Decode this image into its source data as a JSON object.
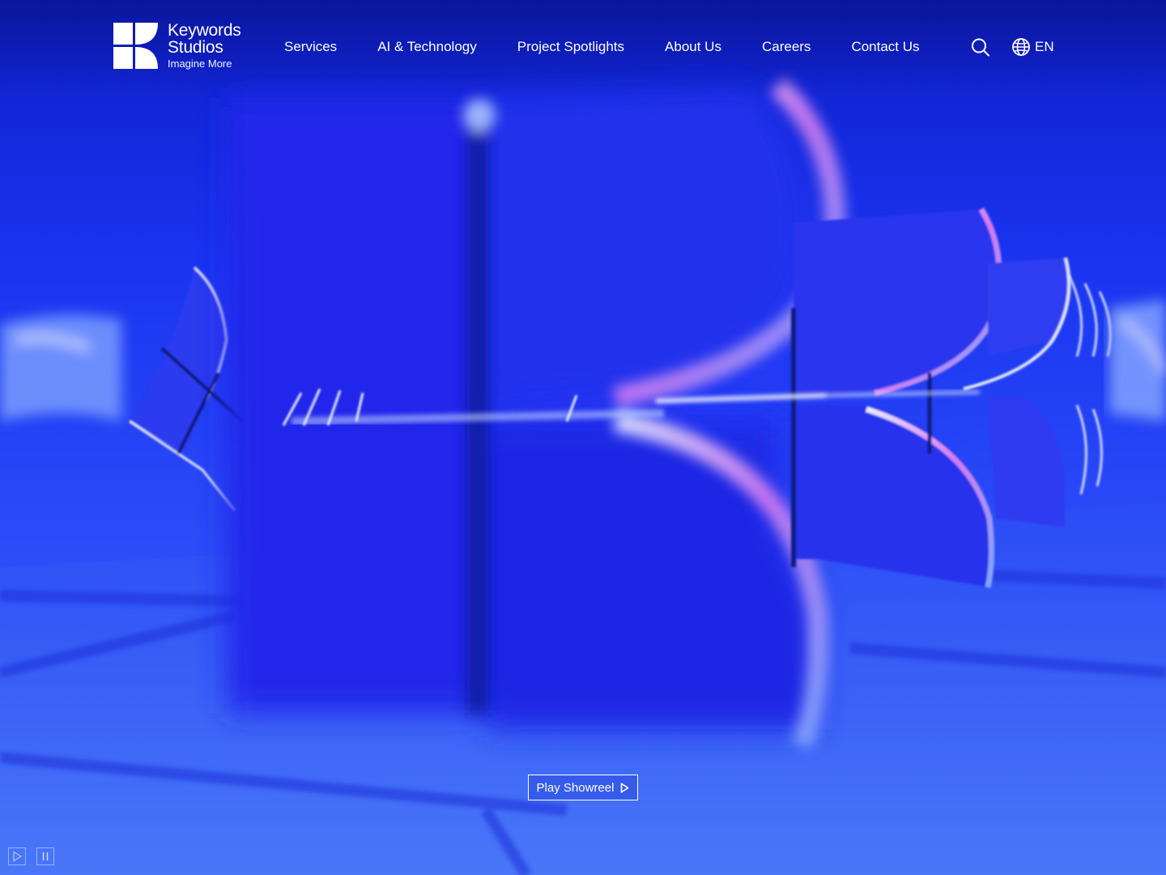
{
  "brand": {
    "name_line1": "Keywords",
    "name_line2": "Studios",
    "tagline": "Imagine More",
    "logo_icon": "keywords-k-logo"
  },
  "nav": {
    "items": [
      {
        "label": "Services"
      },
      {
        "label": "AI & Technology"
      },
      {
        "label": "Project Spotlights"
      },
      {
        "label": "About Us"
      },
      {
        "label": "Careers"
      },
      {
        "label": "Contact Us"
      }
    ],
    "search_icon": "search-icon",
    "language": {
      "icon": "globe-icon",
      "label": "EN"
    }
  },
  "hero": {
    "showreel_label": "Play Showreel",
    "showreel_icon": "play-triangle-icon",
    "controls": {
      "play_icon": "play-icon",
      "pause_icon": "pause-icon"
    },
    "colors": {
      "background": "#1a34f0",
      "accent": "#ffffff"
    }
  }
}
